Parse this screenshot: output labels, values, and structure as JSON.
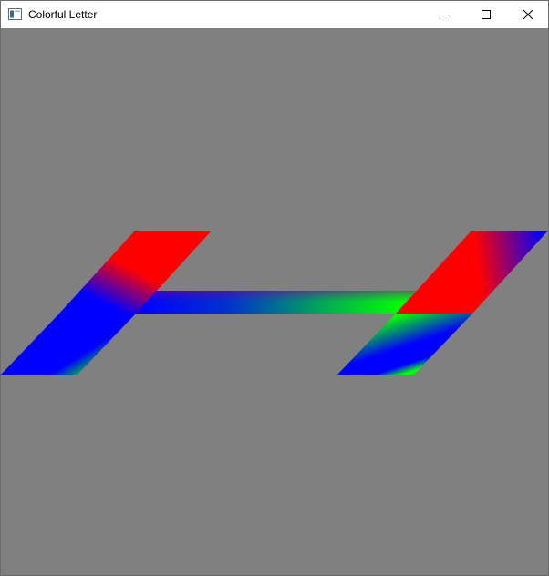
{
  "window": {
    "title": "Colorful Letter",
    "controls": {
      "minimize": "minimize-icon",
      "maximize": "maximize-icon",
      "close": "close-icon"
    }
  },
  "canvas": {
    "background": "#808080",
    "letter_colors": [
      "#ff0000",
      "#0000ff",
      "#00ff00"
    ]
  }
}
